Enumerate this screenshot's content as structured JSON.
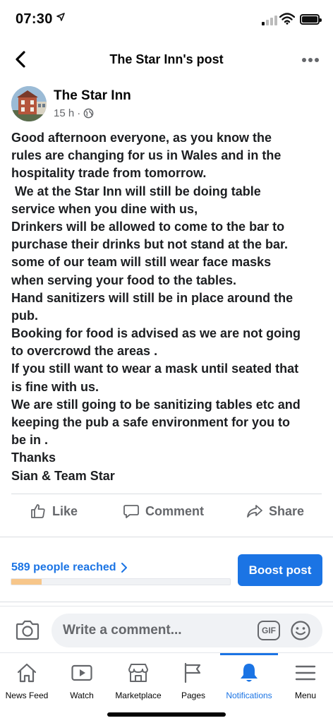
{
  "status_bar": {
    "time": "07:30"
  },
  "header": {
    "title": "The Star Inn's post"
  },
  "post": {
    "author": "The Star Inn",
    "time_ago": "15 h",
    "separator": "·",
    "audience_icon": "globe-icon",
    "lines": [
      "Good afternoon everyone, as you know the",
      "rules are changing for us in Wales and in the",
      "hospitality trade from tomorrow.",
      " We at the Star Inn will still be doing table",
      "service when you dine with us,",
      "Drinkers will be allowed to come to the bar to",
      "purchase their drinks but not stand at the bar.",
      "some of our team will still wear face masks",
      "when serving your food to the tables.",
      "Hand sanitizers will still be in place around the",
      "pub.",
      "Booking for food is advised as we are not going",
      "to overcrowd the areas .",
      "If you still want to wear a mask until seated that",
      "is fine with us.",
      "We are still going to be sanitizing tables etc and",
      "keeping the pub a safe environment for you to",
      "be in .",
      "Thanks",
      "Sian & Team Star"
    ]
  },
  "actions": {
    "like": "Like",
    "comment": "Comment",
    "share": "Share"
  },
  "insights": {
    "reach_text": "589 people reached",
    "reach_progress": 0.14,
    "boost_label": "Boost post"
  },
  "comment_bar": {
    "placeholder": "Write a comment...",
    "gif_label": "GIF"
  },
  "bottom_nav": {
    "items": [
      {
        "label": "News Feed",
        "icon": "home-icon"
      },
      {
        "label": "Watch",
        "icon": "watch-icon"
      },
      {
        "label": "Marketplace",
        "icon": "marketplace-icon"
      },
      {
        "label": "Pages",
        "icon": "flag-icon"
      },
      {
        "label": "Notifications",
        "icon": "bell-icon",
        "active": true
      },
      {
        "label": "Menu",
        "icon": "menu-icon"
      }
    ]
  },
  "colors": {
    "accent": "#1b74e4",
    "secondary_text": "#65676b",
    "progress_fill": "#f7c68a"
  }
}
